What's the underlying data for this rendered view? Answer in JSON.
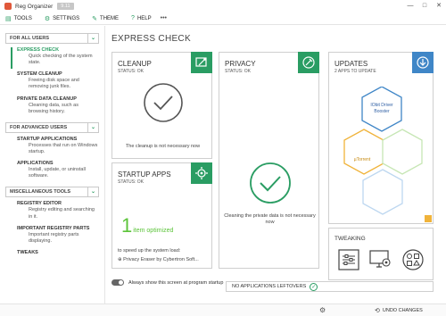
{
  "app": {
    "title": "Reg Organizer",
    "version": "9.11"
  },
  "window_controls": {
    "minimize": "—",
    "maximize": "□",
    "close": "✕"
  },
  "menu": [
    {
      "label": "TOOLS",
      "icon": "tools-icon"
    },
    {
      "label": "SETTINGS",
      "icon": "gear-icon"
    },
    {
      "label": "THEME",
      "icon": "theme-icon"
    },
    {
      "label": "HELP",
      "icon": "help-icon"
    }
  ],
  "menu_more": "•••",
  "sidebar": {
    "section_all": "FOR ALL USERS",
    "express_check": {
      "title": "EXPRESS CHECK",
      "desc": "Quick checking of the system state."
    },
    "system_cleanup": {
      "title": "SYSTEM CLEANUP",
      "desc": "Freeing disk space and removing junk files."
    },
    "private_data": {
      "title": "PRIVATE DATA CLEANUP",
      "desc": "Cleaning data, such as browsing history."
    },
    "section_advanced": "FOR ADVANCED USERS",
    "startup_apps": {
      "title": "STARTUP APPLICATIONS",
      "desc": "Processes that run on Windows startup."
    },
    "applications": {
      "title": "APPLICATIONS",
      "desc": "Install, update, or uninstall software."
    },
    "section_misc": "MISCELLANEOUS TOOLS",
    "registry_editor": {
      "title": "REGISTRY EDITOR",
      "desc": "Registry editing and searching in it."
    },
    "important_parts": {
      "title": "IMPORTANT REGISTRY PARTS",
      "desc": "Important registry parts displaying."
    },
    "tweaks": {
      "title": "TWEAKS"
    }
  },
  "main": {
    "title": "EXPRESS CHECK",
    "cleanup": {
      "title": "CLEANUP",
      "status": "STATUS: OK",
      "note": "The cleanup is not necessary now"
    },
    "privacy": {
      "title": "PRIVACY",
      "status": "STATUS: OK",
      "note": "Cleaning the private data is not necessary now"
    },
    "updates": {
      "title": "UPDATES",
      "status": "2 APPS TO UPDATE",
      "app1": "IObit Driver Booster",
      "app2": "µTorrent"
    },
    "startup": {
      "title": "STARTUP APPS",
      "status": "STATUS: OK",
      "count": "1",
      "count_label": "item optimized",
      "speed": "to speed up the system load:",
      "app": "Privacy Eraser by Cybertron Soft..."
    },
    "tweaking": {
      "title": "TWEAKING"
    },
    "leftovers": "NO APPLICATIONS LEFTOVERS",
    "always_show": "Always show this screen at program startup"
  },
  "statusbar": {
    "undo": "UNDO CHANGES"
  },
  "colors": {
    "accent": "#2a9d63",
    "blue": "#3f86c7",
    "optimized": "#5cc43a",
    "hex_blue": "#3f86c7",
    "hex_orange": "#f0b33a",
    "hex_green": "#bde3a8"
  }
}
